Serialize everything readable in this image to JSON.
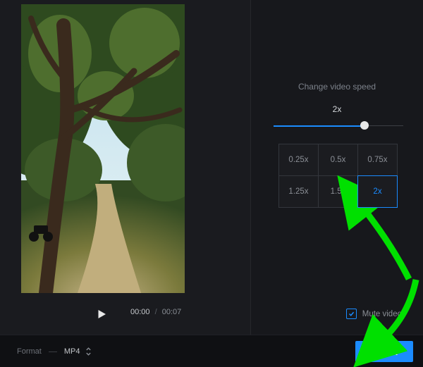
{
  "preview": {
    "current_time": "00:00",
    "duration": "00:07",
    "time_separator": "/"
  },
  "speed": {
    "title": "Change video speed",
    "value_label": "2x",
    "slider_percent": 70,
    "presets": [
      "0.25x",
      "0.5x",
      "0.75x",
      "1.25x",
      "1.5x",
      "2x"
    ],
    "selected_index": 5
  },
  "mute": {
    "label": "Mute video",
    "checked": true
  },
  "bottom": {
    "format_label": "Format",
    "format_value": "MP4",
    "export_label": "Export"
  },
  "colors": {
    "accent": "#1b8cff",
    "arrow": "#00e000"
  }
}
